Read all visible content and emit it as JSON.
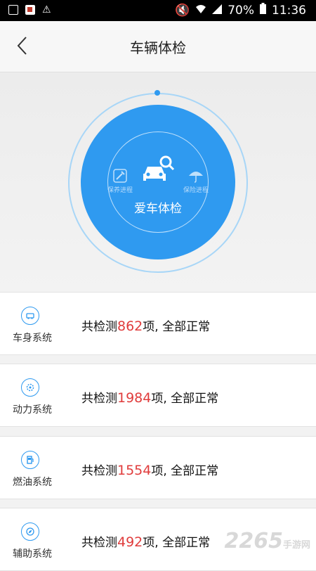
{
  "status_bar": {
    "battery": "70%",
    "time": "11:36"
  },
  "header": {
    "title": "车辆体检"
  },
  "hero": {
    "center_label": "爱车体检",
    "left_label": "保养进程",
    "right_label": "保险进程",
    "accent_color": "#2f9af0"
  },
  "systems": [
    {
      "name": "车身系统",
      "prefix": "共检测",
      "count": "862",
      "suffix": "项, 全部正常",
      "icon": "car-body-icon"
    },
    {
      "name": "动力系统",
      "prefix": "共检测",
      "count": "1984",
      "suffix": "项, 全部正常",
      "icon": "engine-icon"
    },
    {
      "name": "燃油系统",
      "prefix": "共检测",
      "count": "1554",
      "suffix": "项, 全部正常",
      "icon": "fuel-icon"
    },
    {
      "name": "辅助系统",
      "prefix": "共检测",
      "count": "492",
      "suffix": "项, 全部正常",
      "icon": "compass-icon"
    }
  ],
  "watermark": {
    "main": "2265",
    "sub": "手游网"
  }
}
